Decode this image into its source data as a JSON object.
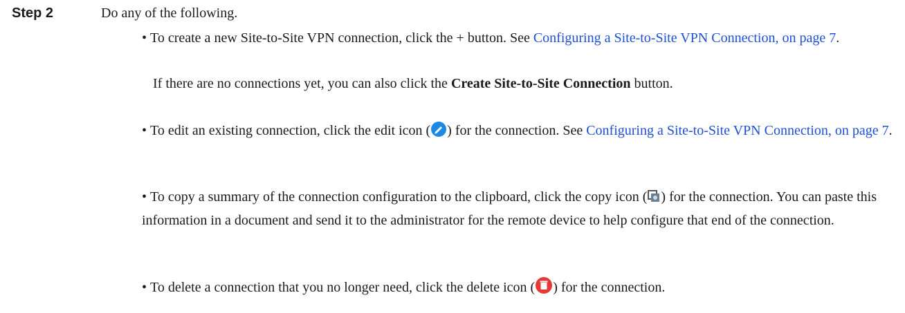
{
  "step": {
    "label": "Step 2",
    "intro": "Do any of the following."
  },
  "items": [
    {
      "pre": "To create a new Site-to-Site VPN connection, click the + button. See ",
      "link": "Configuring a Site-to-Site VPN Connection, on page 7",
      "post": ".",
      "note_pre": "If there are no connections yet, you can also click the ",
      "note_bold": "Create Site-to-Site Connection",
      "note_post": " button."
    },
    {
      "pre": "To edit an existing connection, click the edit icon (",
      "icon": "edit-icon",
      "mid": ") for the connection. See ",
      "link": "Configuring a Site-to-Site VPN Connection, on page 7",
      "post": "."
    },
    {
      "pre": "To copy a summary of the connection configuration to the clipboard, click the copy icon (",
      "icon": "copy-icon",
      "post": ") for the connection. You can paste this information in a document and send it to the administrator for the remote device to help configure that end of the connection."
    },
    {
      "pre": "To delete a connection that you no longer need, click the delete icon (",
      "icon": "delete-icon",
      "post": ") for the connection."
    }
  ],
  "colors": {
    "link": "#1f4fd6",
    "edit_icon": "#1e88e5",
    "delete_icon": "#e53935"
  }
}
